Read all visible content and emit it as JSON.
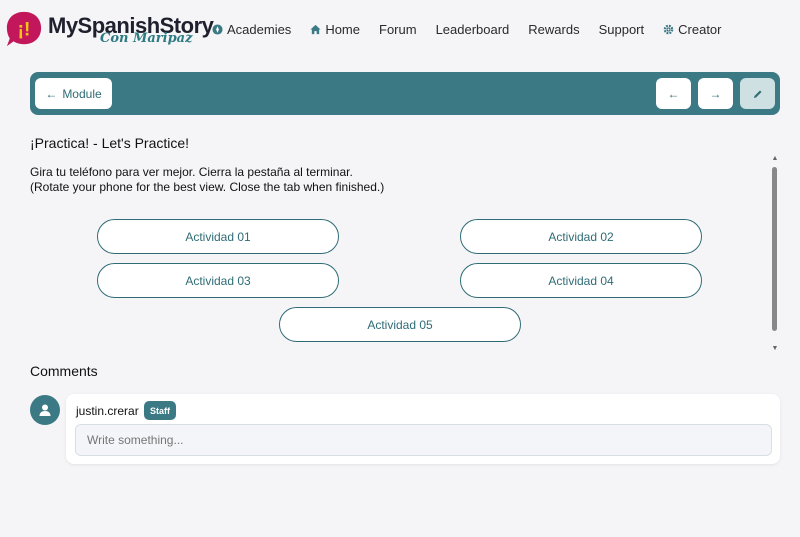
{
  "brand": {
    "title": "MySpanishStory",
    "subtitle": "Con Maripaz",
    "badge_glyph": "¡!",
    "colors": {
      "teal": "#3b7a85",
      "magenta": "#c2185b",
      "yellow": "#f5c518"
    }
  },
  "nav": {
    "items": [
      {
        "label": "Academies",
        "icon": "compass-icon"
      },
      {
        "label": "Home",
        "icon": "home-icon"
      },
      {
        "label": "Forum",
        "icon": ""
      },
      {
        "label": "Leaderboard",
        "icon": ""
      },
      {
        "label": "Rewards",
        "icon": ""
      },
      {
        "label": "Support",
        "icon": ""
      },
      {
        "label": "Creator",
        "icon": "gear-icon"
      }
    ]
  },
  "toolbar": {
    "module_label": "Module",
    "prev_icon": "arrow-left-icon",
    "next_icon": "arrow-right-icon",
    "edit_icon": "pencil-icon"
  },
  "lesson": {
    "title": "¡Practica! - Let's Practice!",
    "instruction_es": "Gira tu teléfono para ver mejor. Cierra la pestaña al terminar.",
    "instruction_en": "(Rotate your phone for the best view. Close the tab when finished.)",
    "activities": [
      "Actividad 01",
      "Actividad 02",
      "Actividad 03",
      "Actividad 04",
      "Actividad 05"
    ]
  },
  "comments": {
    "title": "Comments",
    "user": "justin.crerar",
    "badge": "Staff",
    "placeholder": "Write something..."
  }
}
